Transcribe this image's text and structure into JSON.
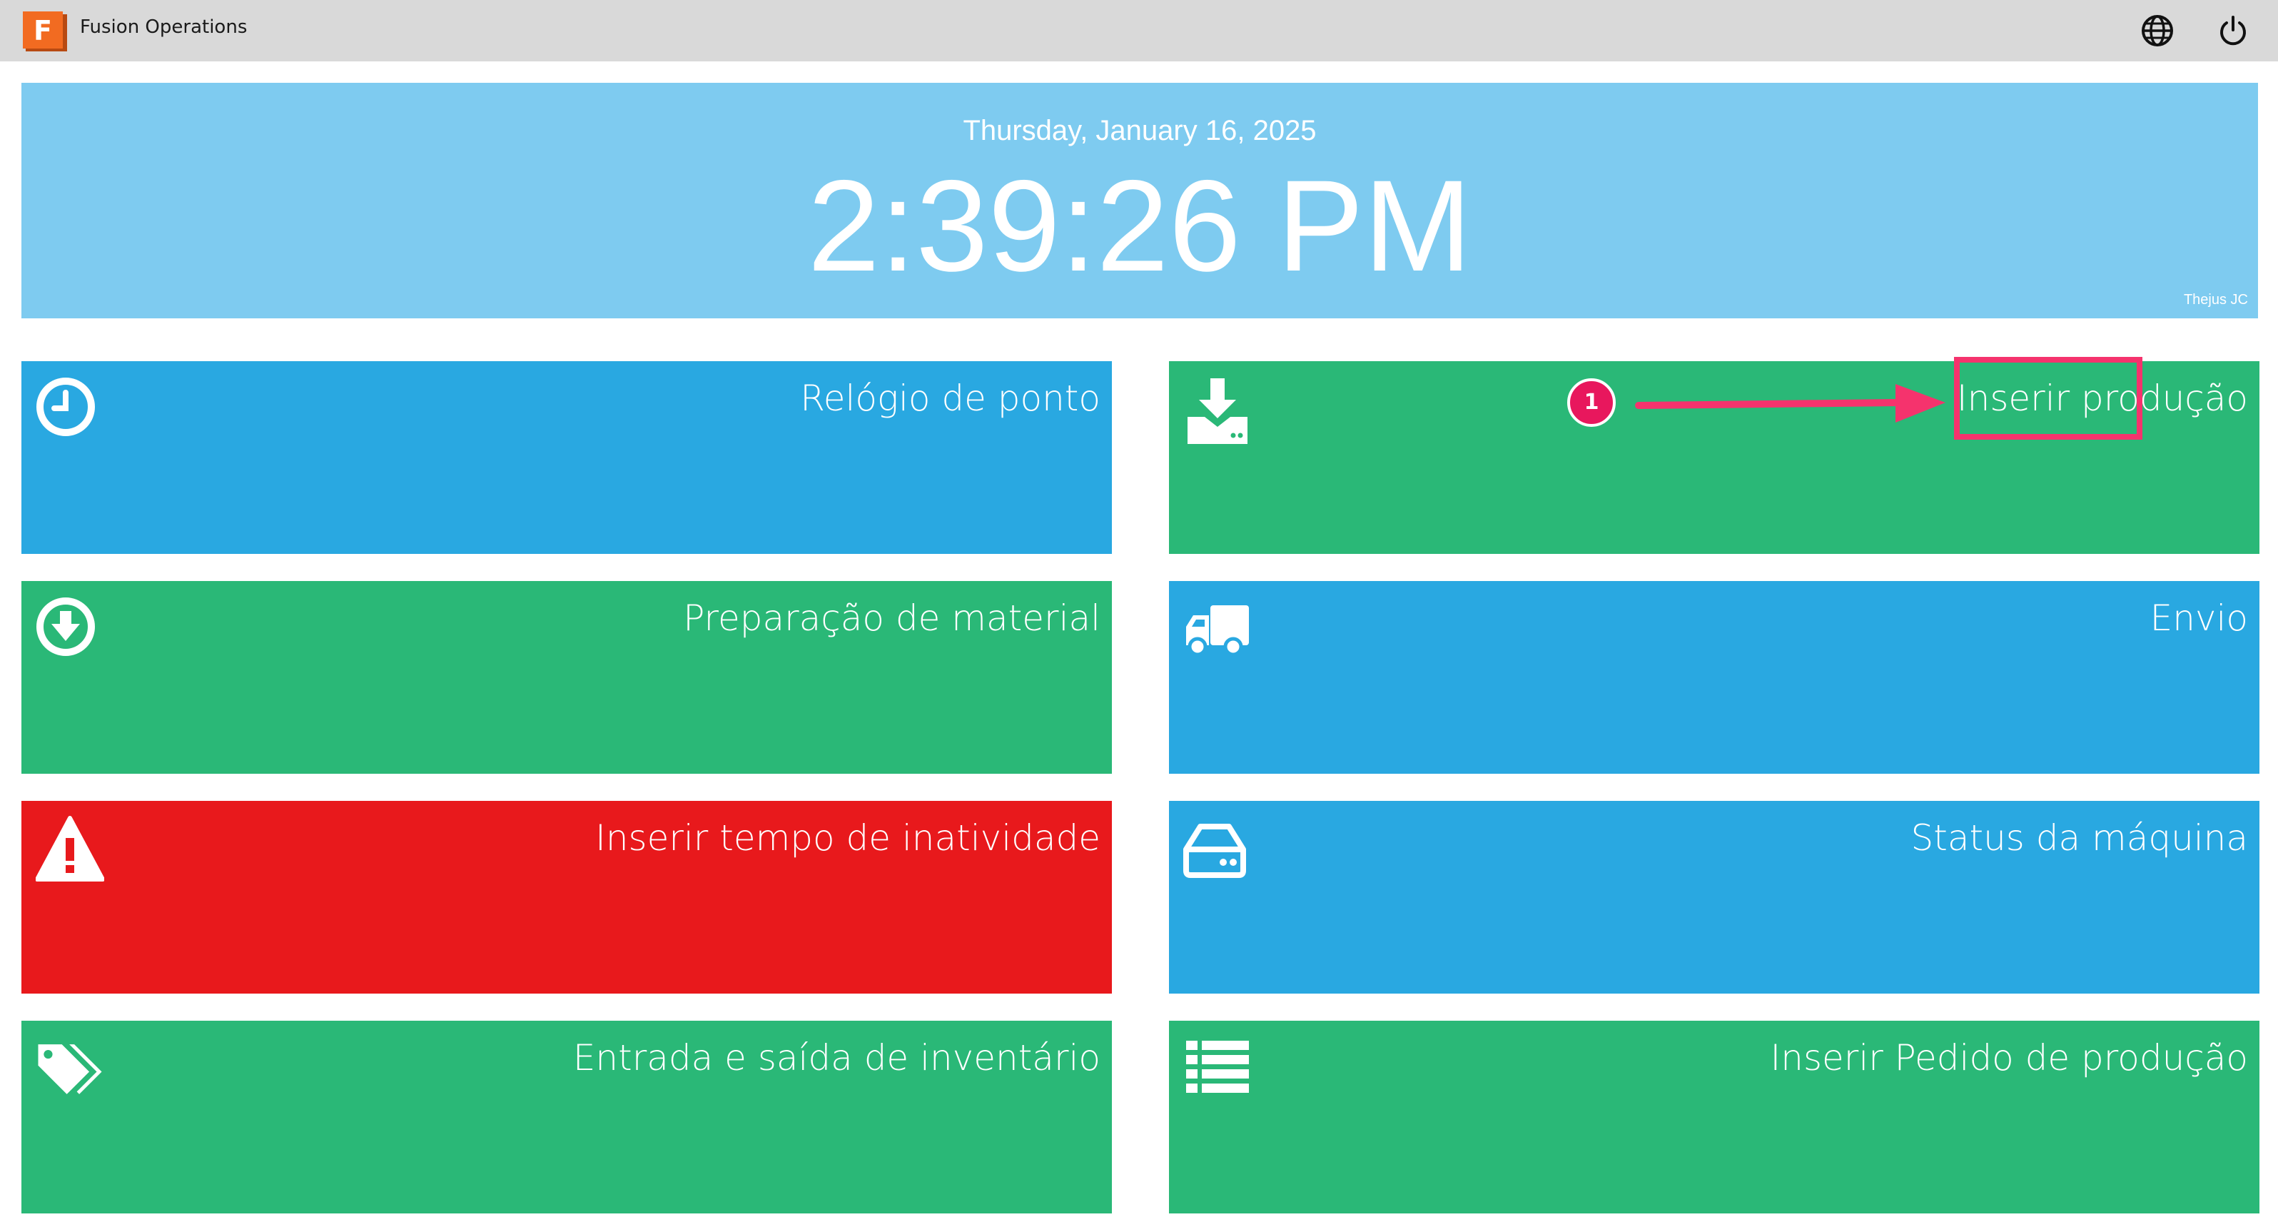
{
  "topbar": {
    "app_title": "Fusion Operations",
    "logo_letter": "F",
    "icons": [
      "globe-icon",
      "power-icon"
    ]
  },
  "clock": {
    "date": "Thursday, January 16, 2025",
    "time": "2:39:26 PM",
    "user": "Thejus JC"
  },
  "tiles": [
    {
      "label": "Relógio de ponto",
      "icon": "clock-icon",
      "color": "#29a8e1"
    },
    {
      "label": "Inserir produção",
      "icon": "download-tray-icon",
      "color": "#2ab877"
    },
    {
      "label": "Preparação de material",
      "icon": "circle-arrow-down-icon",
      "color": "#2ab877"
    },
    {
      "label": "Envio",
      "icon": "truck-icon",
      "color": "#29a8e1"
    },
    {
      "label": "Inserir tempo de inatividade",
      "icon": "warning-icon",
      "color": "#e8191c"
    },
    {
      "label": "Status da máquina",
      "icon": "hard-drive-icon",
      "color": "#29a8e1"
    },
    {
      "label": "Entrada e saída de inventário",
      "icon": "tags-icon",
      "color": "#2ab877"
    },
    {
      "label": "Inserir Pedido de produção",
      "icon": "list-icon",
      "color": "#2ab877"
    }
  ],
  "annotation": {
    "step_number": "1",
    "highlight_color": "#f5336d"
  },
  "colors": {
    "topbar": "#d9d9d9",
    "clock_panel": "#7ecbf0",
    "blue_tile": "#29a8e1",
    "green_tile": "#2ab877",
    "red_tile": "#e8191c",
    "logo": "#f26b21"
  }
}
